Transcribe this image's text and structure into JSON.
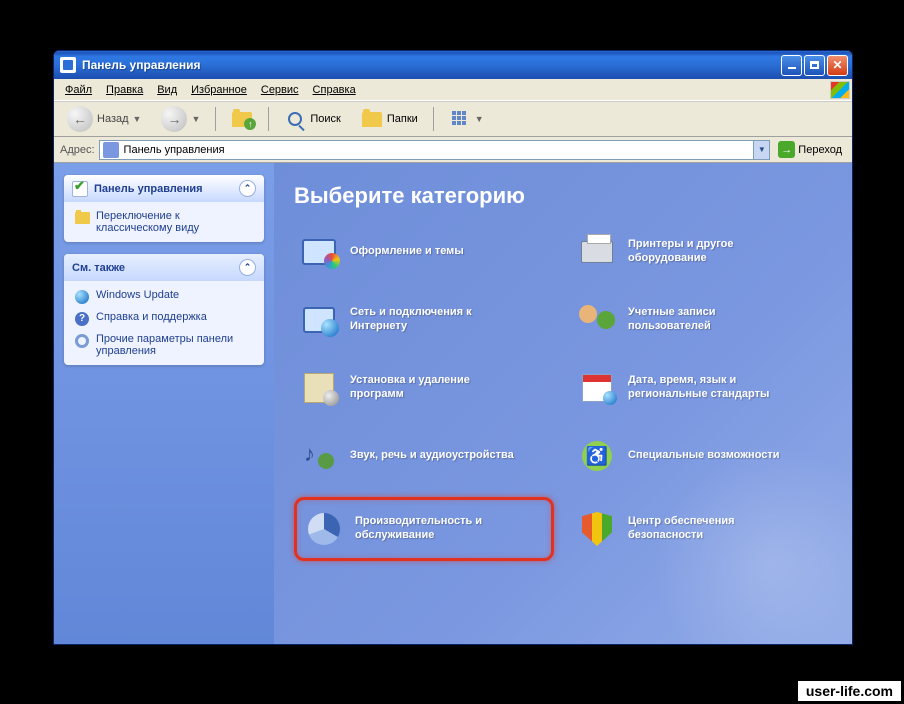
{
  "window": {
    "title": "Панель управления"
  },
  "menu": {
    "file": "Файл",
    "edit": "Правка",
    "view": "Вид",
    "favorites": "Избранное",
    "tools": "Сервис",
    "help": "Справка"
  },
  "toolbar": {
    "back": "Назад",
    "forward": "",
    "search": "Поиск",
    "folders": "Папки"
  },
  "address": {
    "label": "Адрес:",
    "value": "Панель управления",
    "go": "Переход"
  },
  "sidebar": {
    "panel1": {
      "title": "Панель управления",
      "link": "Переключение к классическому виду"
    },
    "panel2": {
      "title": "См. также",
      "items": [
        "Windows Update",
        "Справка и поддержка",
        "Прочие параметры панели управления"
      ]
    }
  },
  "main": {
    "heading": "Выберите категорию",
    "categories": [
      {
        "id": "appearance",
        "label": "Оформление и темы"
      },
      {
        "id": "printers",
        "label": "Принтеры и другое оборудование"
      },
      {
        "id": "network",
        "label": "Сеть и подключения к Интернету"
      },
      {
        "id": "users",
        "label": "Учетные записи пользователей"
      },
      {
        "id": "addremove",
        "label": "Установка и удаление программ"
      },
      {
        "id": "datetime",
        "label": "Дата, время, язык и региональные стандарты"
      },
      {
        "id": "sound",
        "label": "Звук, речь и аудиоустройства"
      },
      {
        "id": "accessibility",
        "label": "Специальные возможности"
      },
      {
        "id": "performance",
        "label": "Производительность и обслуживание",
        "highlight": true
      },
      {
        "id": "security",
        "label": "Центр обеспечения безопасности"
      }
    ]
  },
  "watermark": "user-life.com"
}
